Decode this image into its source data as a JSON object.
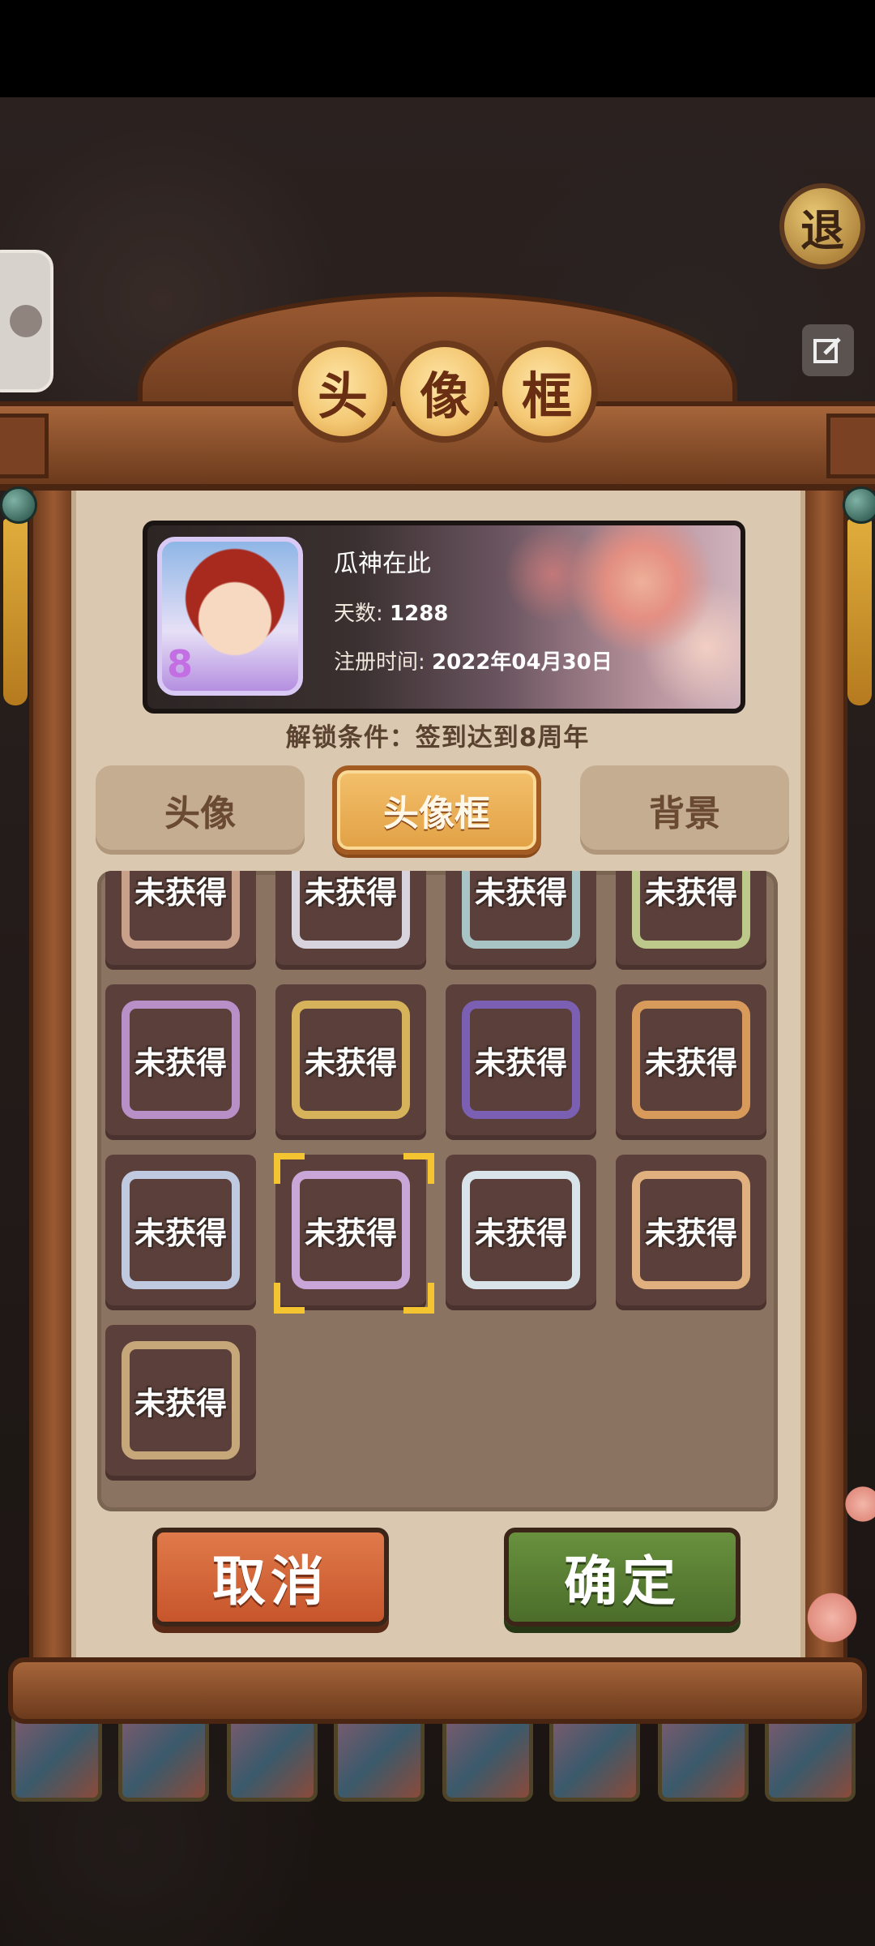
{
  "modal": {
    "title_chars": [
      "头",
      "像",
      "框"
    ],
    "profile": {
      "name": "瓜神在此",
      "days_label": "天数:",
      "days_value": "1288",
      "reg_label": "注册时间:",
      "reg_value": "2022年04月30日",
      "avatar_badge": "8"
    },
    "unlock_condition": "解锁条件：签到达到8周年",
    "tabs": [
      {
        "label": "头像",
        "active": false
      },
      {
        "label": "头像框",
        "active": true
      },
      {
        "label": "背景",
        "active": false
      }
    ],
    "frames": [
      {
        "status": "未获得",
        "color": "#c9a08a"
      },
      {
        "status": "未获得",
        "color": "#d8d4de"
      },
      {
        "status": "未获得",
        "color": "#a9c4c4"
      },
      {
        "status": "未获得",
        "color": "#bcc98a"
      },
      {
        "status": "未获得",
        "color": "#b98fc8"
      },
      {
        "status": "未获得",
        "color": "#d6b25a"
      },
      {
        "status": "未获得",
        "color": "#7a5fb3"
      },
      {
        "status": "未获得",
        "color": "#d79a5b"
      },
      {
        "status": "未获得",
        "color": "#bfc9e0"
      },
      {
        "status": "未获得",
        "color": "#c8a6d8",
        "selected": true
      },
      {
        "status": "未获得",
        "color": "#d9e3ea"
      },
      {
        "status": "未获得",
        "color": "#e0b07f"
      },
      {
        "status": "未获得",
        "color": "#c5a77a"
      }
    ],
    "buttons": {
      "cancel": "取消",
      "confirm": "确定"
    }
  },
  "background": {
    "exit_label": "退"
  }
}
